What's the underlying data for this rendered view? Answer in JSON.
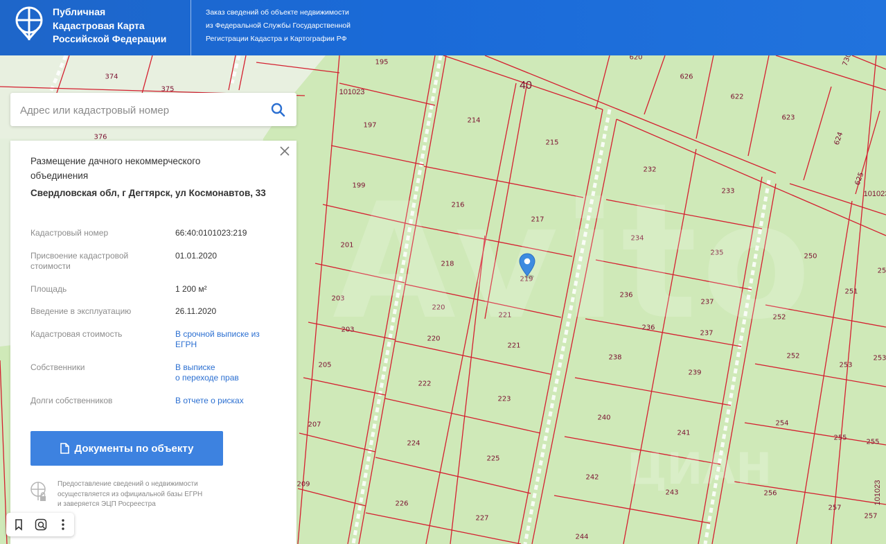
{
  "header": {
    "brand_line1": "Публичная",
    "brand_line2": "Кадастровая Карта",
    "brand_line3": "Российской Федерации",
    "tagline_line1": "Заказ сведений об объекте недвижимости",
    "tagline_line2": "из Федеральной Службы Государственной",
    "tagline_line3": "Регистрации Кадастра и Картографии РФ"
  },
  "search": {
    "placeholder": "Адрес или кадастровый номер"
  },
  "panel": {
    "type": "Размещение дачного некоммерческого объединения",
    "address": "Свердловская обл, г Дегтярск, ул Космонавтов, 33",
    "rows": [
      {
        "label": "Кадастровый номер",
        "value": "66:40:0101023:219"
      },
      {
        "label": "Присвоение кадастровой стоимости",
        "value": "01.01.2020"
      },
      {
        "label": "Площадь",
        "value": "1 200 м²"
      },
      {
        "label": "Введение в эксплуатацию",
        "value": "26.11.2020"
      },
      {
        "label": "Кадастровая стоимость",
        "value": "В срочной выписке из ЕГРН"
      },
      {
        "label": "Собственники",
        "value_line1": "В выписке",
        "value_line2": "о переходе прав"
      },
      {
        "label": "Долги собственников",
        "value": "В отчете о рисках"
      }
    ],
    "documents_button": "Документы по объекту",
    "footer_line1": "Предоставление сведений о недвижимости",
    "footer_line2": "осуществляется из официальной базы ЕГРН",
    "footer_line3": "и заверяется ЭЦП Росреестра"
  },
  "map": {
    "block_labels": [
      "101023",
      "101023",
      "101023"
    ],
    "big_label": "40",
    "parcel_numbers": [
      "374",
      "375",
      "376",
      "195",
      "197",
      "199",
      "201",
      "203",
      "203",
      "205",
      "207",
      "209",
      "214",
      "215",
      "216",
      "217",
      "218",
      "219",
      "220",
      "220",
      "221",
      "221",
      "222",
      "223",
      "224",
      "225",
      "226",
      "227",
      "232",
      "233",
      "234",
      "235",
      "236",
      "236",
      "237",
      "237",
      "238",
      "239",
      "240",
      "241",
      "242",
      "243",
      "244",
      "250",
      "251",
      "252",
      "252",
      "253",
      "254",
      "255",
      "256",
      "257",
      "620",
      "626",
      "622",
      "623",
      "624",
      "625",
      "730",
      "25",
      "253",
      "255",
      "257"
    ],
    "marker_parcel": "219"
  },
  "watermark": {
    "text": "Avito",
    "sub": "ЦИАН"
  },
  "colors": {
    "header": "#1e66c9",
    "button": "#3d82e0",
    "parcel_line": "#d41f2f",
    "land": "#cfe9b8",
    "link": "#2b6fd1"
  },
  "icons": [
    "logo-icon",
    "search-icon",
    "close-icon",
    "document-icon",
    "egrn-icon",
    "bookmark-icon",
    "lens-icon",
    "more-icon",
    "location-marker-icon"
  ]
}
